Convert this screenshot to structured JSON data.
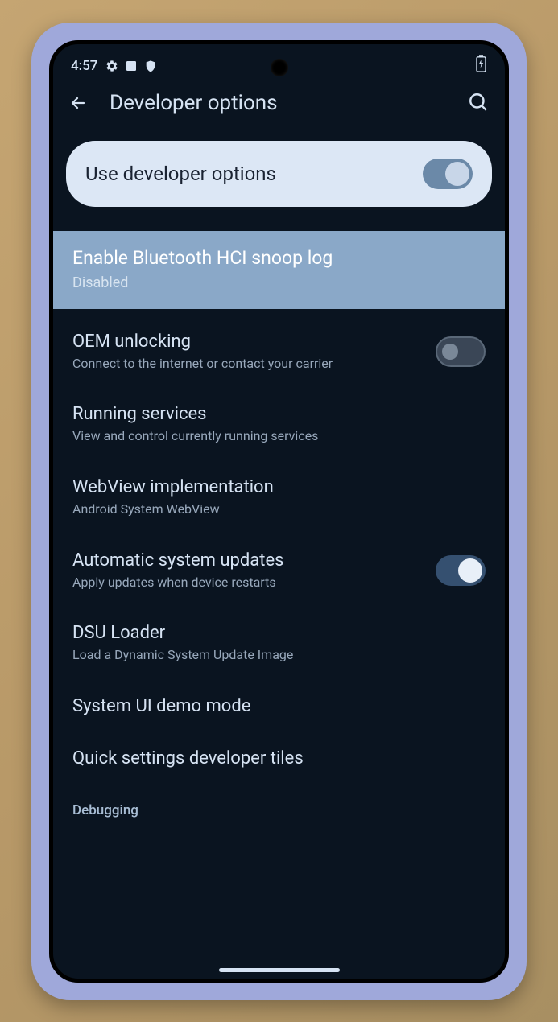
{
  "status": {
    "time": "4:57"
  },
  "header": {
    "title": "Developer options"
  },
  "master": {
    "label": "Use developer options",
    "enabled": true
  },
  "highlighted": {
    "title": "Enable Bluetooth HCI snoop log",
    "subtitle": "Disabled"
  },
  "items": [
    {
      "title": "OEM unlocking",
      "subtitle": "Connect to the internet or contact your carrier",
      "toggle": false
    },
    {
      "title": "Running services",
      "subtitle": "View and control currently running services"
    },
    {
      "title": "WebView implementation",
      "subtitle": "Android System WebView"
    },
    {
      "title": "Automatic system updates",
      "subtitle": "Apply updates when device restarts",
      "toggle": true
    },
    {
      "title": "DSU Loader",
      "subtitle": "Load a Dynamic System Update Image"
    },
    {
      "title": "System UI demo mode"
    },
    {
      "title": "Quick settings developer tiles"
    }
  ],
  "section": {
    "debugging": "Debugging"
  }
}
